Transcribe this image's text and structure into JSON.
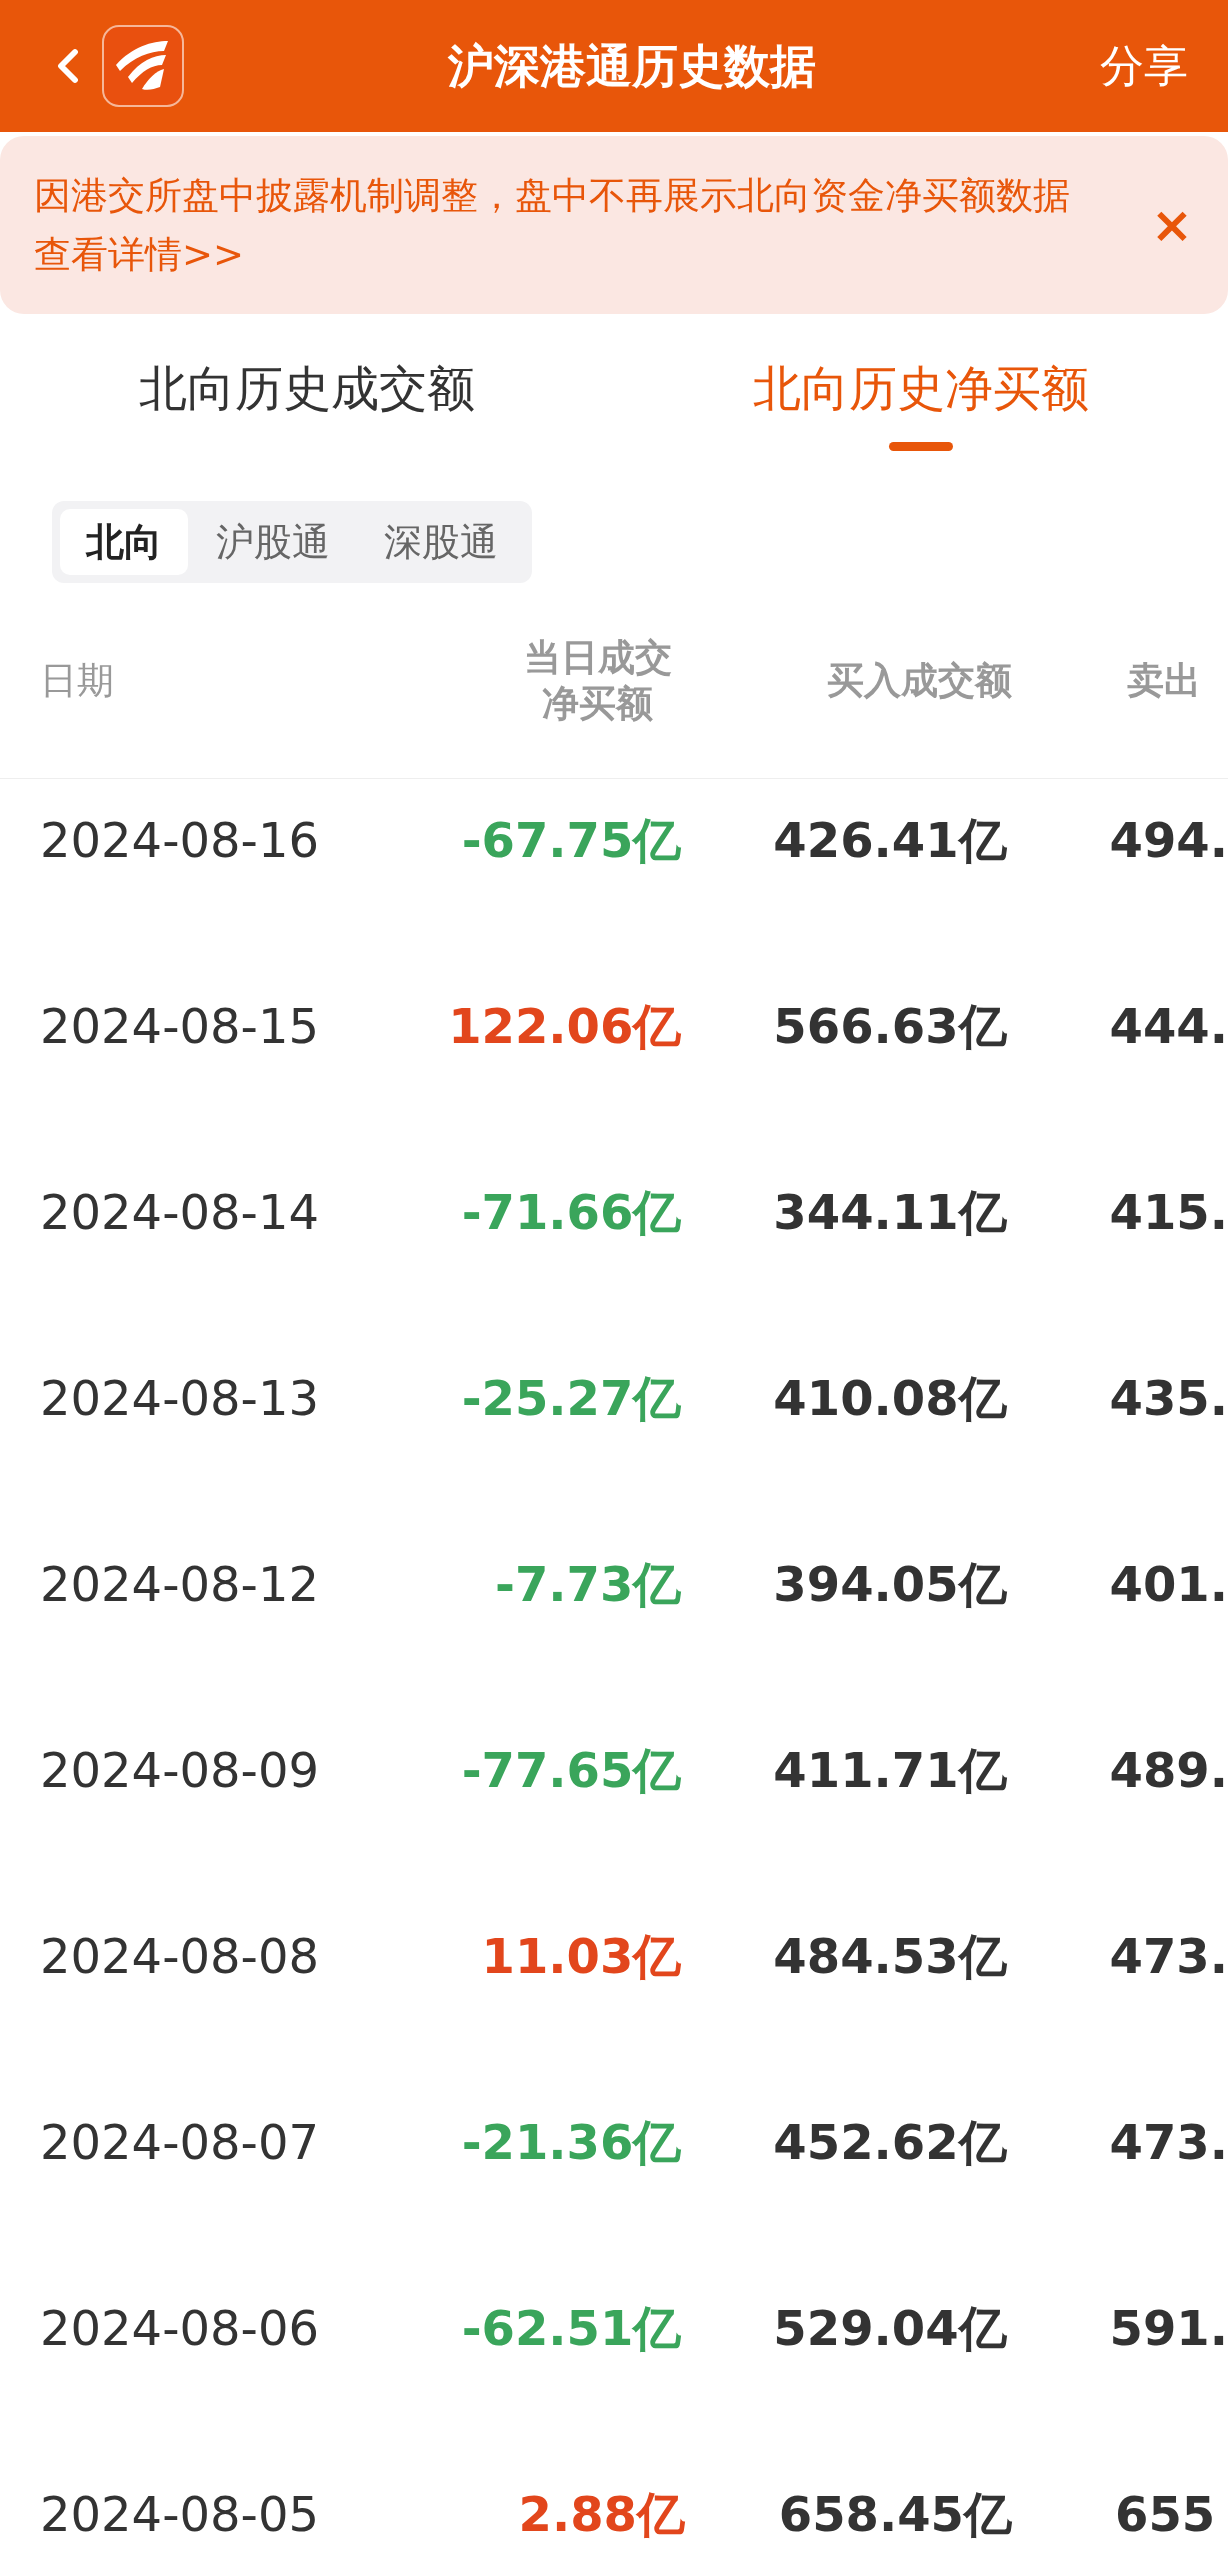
{
  "header": {
    "title": "沪深港通历史数据",
    "share": "分享"
  },
  "notice": {
    "text": "因港交所盘中披露机制调整，盘中不再展示北向资金净买额数据",
    "link": "查看详情>>",
    "close": "×"
  },
  "tabs": [
    {
      "label": "北向历史成交额",
      "selected": false
    },
    {
      "label": "北向历史净买额",
      "selected": true
    }
  ],
  "segments": [
    {
      "label": "北向",
      "selected": true
    },
    {
      "label": "沪股通",
      "selected": false
    },
    {
      "label": "深股通",
      "selected": false
    }
  ],
  "table": {
    "columns": [
      "日期",
      "当日成交净买额",
      "买入成交额",
      "卖出"
    ],
    "rows": [
      {
        "date": "2024-08-16",
        "net": "-67.75亿",
        "color": "#3aa55b",
        "buy": "426.41亿",
        "sell": "494."
      },
      {
        "date": "2024-08-15",
        "net": "122.06亿",
        "color": "#e2461c",
        "buy": "566.63亿",
        "sell": "444."
      },
      {
        "date": "2024-08-14",
        "net": "-71.66亿",
        "color": "#3aa55b",
        "buy": "344.11亿",
        "sell": "415."
      },
      {
        "date": "2024-08-13",
        "net": "-25.27亿",
        "color": "#3aa55b",
        "buy": "410.08亿",
        "sell": "435."
      },
      {
        "date": "2024-08-12",
        "net": "-7.73亿",
        "color": "#3aa55b",
        "buy": "394.05亿",
        "sell": "401."
      },
      {
        "date": "2024-08-09",
        "net": "-77.65亿",
        "color": "#3aa55b",
        "buy": "411.71亿",
        "sell": "489."
      },
      {
        "date": "2024-08-08",
        "net": "11.03亿",
        "color": "#e2461c",
        "buy": "484.53亿",
        "sell": "473."
      },
      {
        "date": "2024-08-07",
        "net": "-21.36亿",
        "color": "#3aa55b",
        "buy": "452.62亿",
        "sell": "473."
      },
      {
        "date": "2024-08-06",
        "net": "-62.51亿",
        "color": "#3aa55b",
        "buy": "529.04亿",
        "sell": "591."
      },
      {
        "date": "2024-08-05",
        "net": "2.88亿",
        "color": "#e2461c",
        "buy": "658.45亿",
        "sell": "655"
      }
    ]
  }
}
